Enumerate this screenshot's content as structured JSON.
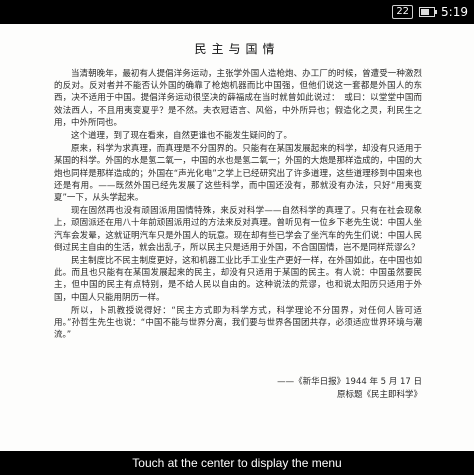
{
  "status": {
    "notification_count": "22",
    "time": "5:19"
  },
  "article": {
    "title": "民主与国情",
    "paragraphs": [
      "当清朝晚年，最初有人提倡洋务运动，主张学外国人造枪炮、办工厂的时候，曾遭受一种激烈的反对。反对者并不能否认外国的确靠了枪炮机器而比中国强，但他们说这一套都是外国人的东西，决不适用于中国。提倡洋务运动很坚决的薛福成在当时就曾如此说过：　或曰：以堂堂中国而效法西人，不且用夷变夏乎？是不然。夫衣冠语言、风俗，中外所异也；假造化之灵，利民生之用，中外所同也。",
      "这个道理，到了现在看来，自然更谁也不能发生疑问的了。",
      "原来，科学为求真理，而真理是不分国界的。只能有在某国发展起来的科学，却没有只适用于某国的科学。外国的水是氢二氧一，中国的水也是氢二氧一；外国的大炮是那样造成的，中国的大炮也同样是那样造成的；外国在“声光化电”之学上已经研究出了许多道理，这些道理移到中国来也还是有用。——既然外国已经先发展了这些科学，而中国还没有，那就没有办法，只好“用夷变夏”一下，从头学起来。",
      "现在固然再也没有顽固派用国情特殊，来反对科学——自然科学的真理了。只有在社会现象上，顽固派还在用八十年前顽固派用过的方法来反对真理。曾听见有一位乡下老先生说：中国人坐汽车会发晕，这就证明汽车只是外国人的玩意。现在却有些已学会了坐汽车的先生们说：中国人民倒过民主自由的生活，就会出乱子，所以民主只是适用于外国，不合国国情，岂不是同样荒谬么？",
      "民主制度比不民主制度更好，这和机器工业比手工业生产更好一样，在外国如此，在中国也如此。而且也只能有在某国发展起来的民主，却没有只适用于某国的民主。有人说：中国虽然要民主，但中国的民主有点特别，是不给人民以自由的。这种说法的荒谬，也和说太阳历只适用于外国，中国人只能用阴历一样。",
      "所以，卜凯教授说得好：“民主方式即为科学方式，科学理论不分国界，对任何人皆可适用。”孙哲生先生也说：“中国不能与世界分离，我们要与世界各国团共存，必须适应世界环境与潮流。”"
    ],
    "citation_source": "——《新华日报》1944 年 5 月 17 日",
    "citation_original": "原标题《民主即科学》"
  },
  "footer": {
    "hint": "Touch at the center to display the menu"
  }
}
